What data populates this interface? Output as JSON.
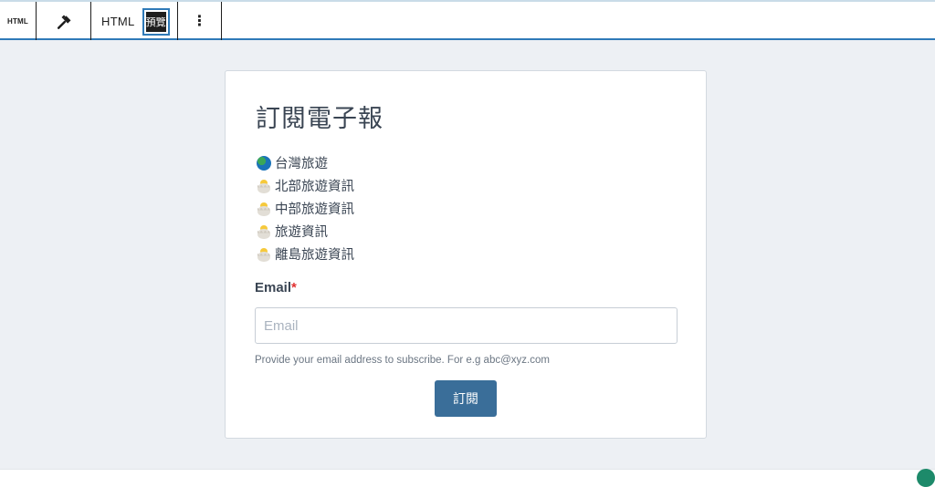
{
  "toolbar": {
    "block_icon_label": "HTML",
    "transform_icon": "hammer-icon",
    "html_mode_label": "HTML",
    "preview_mode_label": "預覽",
    "more_icon": "⋮"
  },
  "colors": {
    "accent": "#2f7ab8",
    "canvas_bg": "#edf0f4",
    "button_bg": "#3a6e99",
    "required": "#e03131"
  },
  "form": {
    "title": "訂閱電子報",
    "topics": [
      {
        "icon": "globe-icon",
        "label": "台灣旅遊"
      },
      {
        "icon": "hatching-chick-icon",
        "label": "北部旅遊資訊"
      },
      {
        "icon": "hatching-chick-icon",
        "label": "中部旅遊資訊"
      },
      {
        "icon": "hatching-chick-icon",
        "label": "旅遊資訊"
      },
      {
        "icon": "hatching-chick-icon",
        "label": "離島旅遊資訊"
      }
    ],
    "email_label": "Email",
    "required_mark": "*",
    "email_placeholder": "Email",
    "email_value": "",
    "help_text": "Provide your email address to subscribe. For e.g abc@xyz.com",
    "submit_label": "訂閱"
  }
}
